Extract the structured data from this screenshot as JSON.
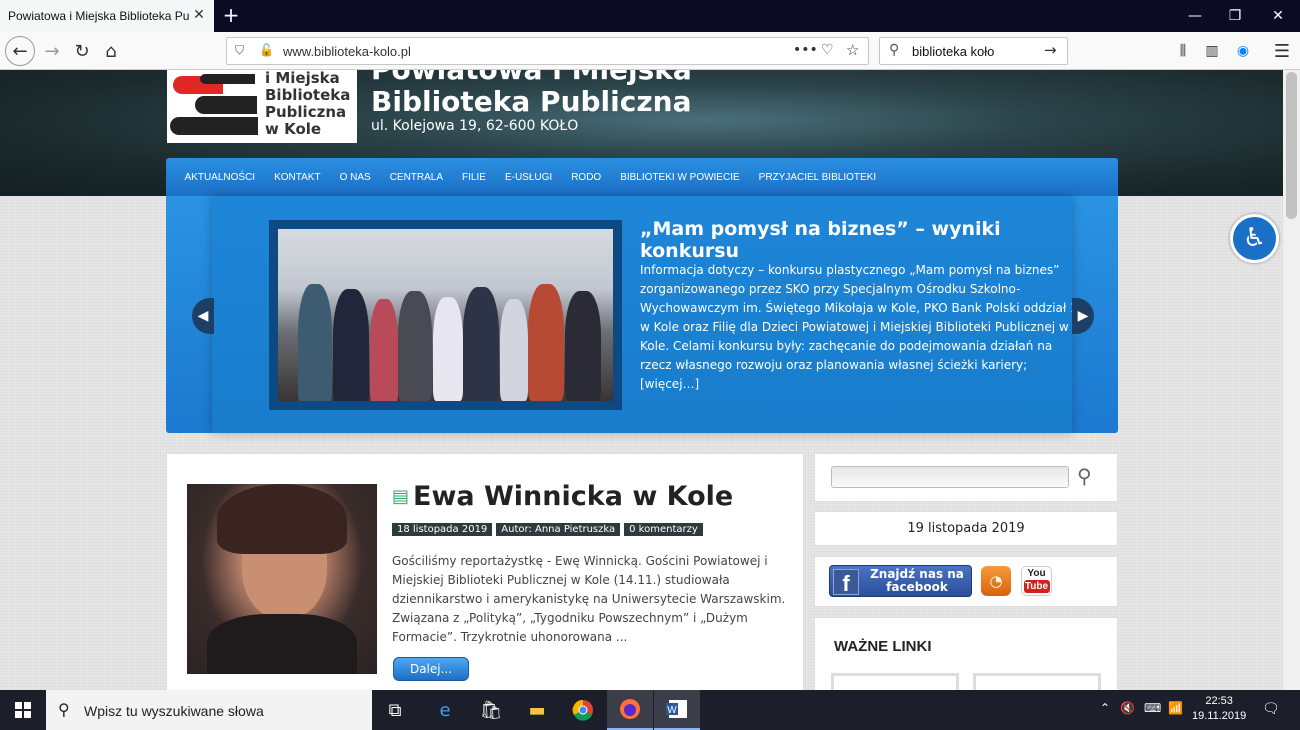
{
  "browser": {
    "tab_title": "Powiatowa i Miejska Biblioteka Publ",
    "url": "www.biblioteka-kolo.pl",
    "search_query": "biblioteka koło"
  },
  "site": {
    "logo_text": "i Miejska Biblioteka Publiczna w Kole",
    "title_line1": "Powiatowa i Miejska",
    "title_line2": "Biblioteka Publiczna",
    "address": "ul. Kolejowa 19, 62-600 KOŁO"
  },
  "menu": [
    "AKTUALNOŚCI",
    "KONTAKT",
    "O NAS",
    "CENTRALA",
    "FILIE",
    "E-USŁUGI",
    "RODO",
    "BIBLIOTEKI W POWIECIE",
    "PRZYJACIEL BIBLIOTEKI"
  ],
  "slider": {
    "title": "„Mam pomysł na biznes” – wyniki konkursu",
    "text": "Informacja dotyczy –  konkursu plastycznego „Mam pomysł na biznes” zorganizowanego przez  SKO przy Specjalnym Ośrodku Szkolno-Wychowawczym im. Świętego Mikołaja w Kole, PKO Bank Polski oddział 1 w Kole oraz Filię dla Dzieci Powiatowej i Miejskiej Biblioteki Publicznej w Kole. Celami konkursu były:  zachęcanie do podejmowania działań na rzecz własnego rozwoju oraz planowania własnej ścieżki kariery; ",
    "more": "[więcej…]"
  },
  "post": {
    "title": "Ewa Winnicka w Kole",
    "date": "18 listopada 2019",
    "author": "Autor: Anna Pietruszka",
    "comments": "0 komentarzy",
    "excerpt": "Gościliśmy reportażystkę  - Ewę Winnicką. Gościni Powiatowej i Miejskiej Biblioteki Publicznej w Kole (14.11.) studiowała dziennikarstwo i amerykanistykę na Uniwersytecie Warszawskim. Związana z „Polityką”, „Tygodniku Powszechnym” i „Dużym Formacie”. Trzykrotnie uhonorowana ...",
    "more": "Dalej..."
  },
  "sidebar": {
    "date": "19 listopada 2019",
    "facebook_label": "Znajdź nas na facebook",
    "youtube_top": "You",
    "youtube_bottom": "Tube",
    "links_title": "WAŻNE LINKI"
  },
  "taskbar": {
    "search_placeholder": "Wpisz tu wyszukiwane słowa",
    "time": "22:53",
    "date": "19.11.2019"
  },
  "colors": {
    "menu_blue": "#1b6fc6",
    "header_dark": "#1b2a2c",
    "accent_red": "#e32726"
  }
}
